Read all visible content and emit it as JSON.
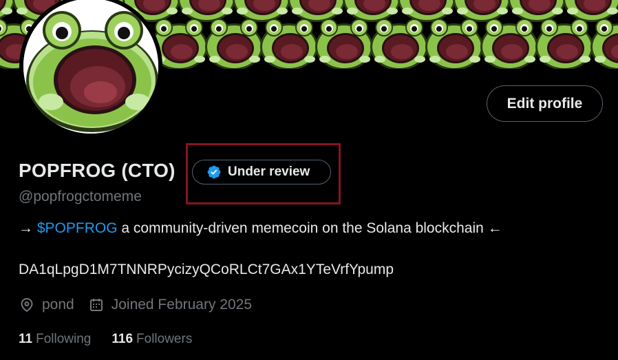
{
  "profile": {
    "display_name": "POPFROG (CTO)",
    "verification_label": "Under review",
    "handle": "@popfrogctomeme",
    "bio_prefix": "→ ",
    "bio_cashtag": "$POPFROG",
    "bio_suffix": " a community-driven memecoin on the Solana blockchain ←",
    "contract_address": "DA1qLpgD1M7TNNRPycizyQCoRLCt7GAx1YTeVrfYpump",
    "location": "pond",
    "joined": "Joined February 2025",
    "following_count": "11",
    "following_label": "Following",
    "followers_count": "116",
    "followers_label": "Followers"
  },
  "actions": {
    "edit_profile_label": "Edit profile"
  },
  "icons": {
    "verified": "verified-badge-icon",
    "location": "location-pin-icon",
    "calendar": "calendar-icon"
  },
  "colors": {
    "background": "#000000",
    "text_primary": "#e7e9ea",
    "text_secondary": "#71767b",
    "link": "#1d9bf0",
    "verified_badge": "#1d9bf0",
    "highlight_box": "#8a1322",
    "frog_green": "#8bc34a",
    "frog_mouth": "#5a1a22"
  }
}
